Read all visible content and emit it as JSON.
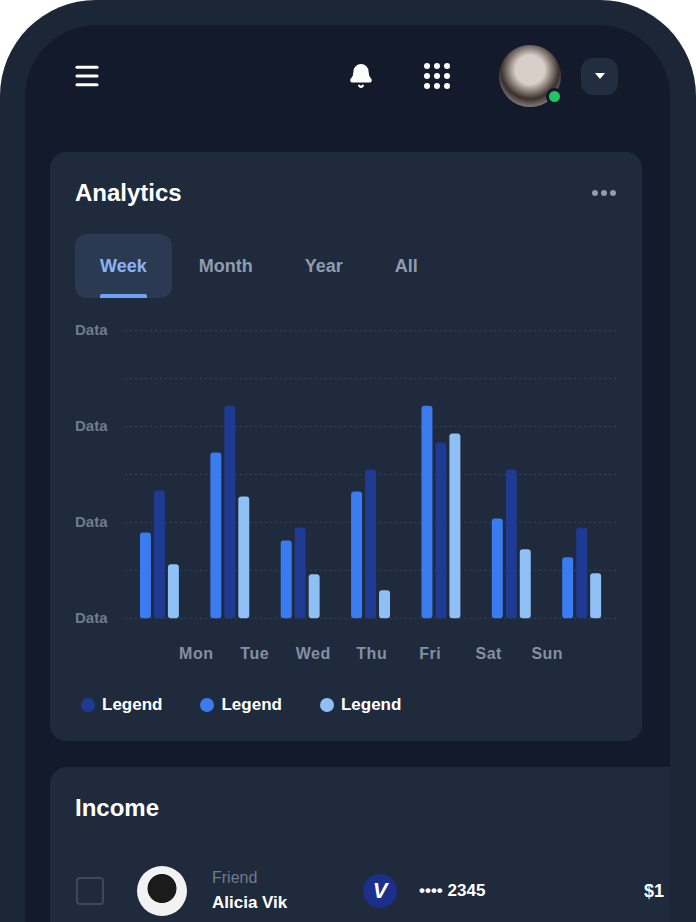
{
  "header": {
    "user": {
      "online": true
    }
  },
  "analytics": {
    "title": "Analytics",
    "tabs": [
      {
        "label": "Week",
        "selected": true
      },
      {
        "label": "Month",
        "selected": false
      },
      {
        "label": "Year",
        "selected": false
      },
      {
        "label": "All",
        "selected": false
      }
    ],
    "chart": {
      "y_ticks": [
        "Data",
        "Data",
        "Data",
        "Data"
      ],
      "days": [
        "Mon",
        "Tue",
        "Wed",
        "Thu",
        "Fri",
        "Sat",
        "Sun"
      ],
      "series": [
        {
          "legend": "Legend",
          "color": "#1f3a93",
          "values": [
            128,
            213,
            91,
            149,
            176,
            149,
            91
          ]
        },
        {
          "legend": "Legend",
          "color": "#3b7bf0",
          "values": [
            86,
            166,
            78,
            127,
            213,
            100,
            61
          ]
        },
        {
          "legend": "Legend",
          "color": "#8ebff5",
          "values": [
            54,
            122,
            44,
            28,
            185,
            69,
            45
          ]
        }
      ]
    }
  },
  "income": {
    "title": "Income",
    "rows": [
      {
        "checked": false,
        "category": "Friend",
        "name": "Alicia Vik",
        "card_logo": "V",
        "card_number": "•••• 2345",
        "amount": "$1"
      }
    ]
  }
}
